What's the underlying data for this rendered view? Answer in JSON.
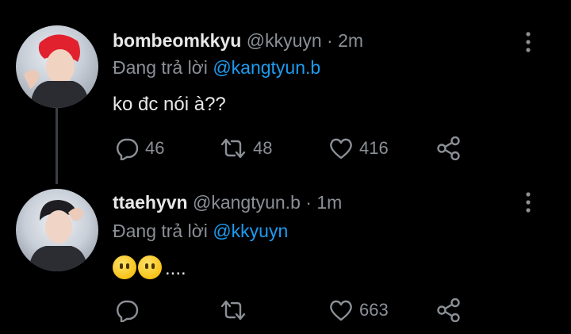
{
  "tweets": [
    {
      "name": "bombeomkkyu",
      "handle": "@kkyuyn",
      "separator": "·",
      "time": "2m",
      "reply_prefix": "Đang trả lời",
      "reply_to": "@kangtyun.b",
      "text": "ko đc nói à??",
      "replies": "46",
      "retweets": "48",
      "likes": "416"
    },
    {
      "name": "ttaehyvn",
      "handle": "@kangtyun.b",
      "separator": "·",
      "time": "1m",
      "reply_prefix": "Đang trả lời",
      "reply_to": "@kkyuyn",
      "text_suffix": "....",
      "emoji": [
        "face-without-mouth",
        "face-without-mouth"
      ],
      "likes": "663"
    }
  ],
  "colors": {
    "background": "#000000",
    "mention": "#1d9bf0",
    "muted": "#8b9096",
    "text": "#e8e8e8"
  },
  "icons": [
    "more-vertical-icon",
    "reply-icon",
    "retweet-icon",
    "like-icon",
    "share-icon"
  ]
}
